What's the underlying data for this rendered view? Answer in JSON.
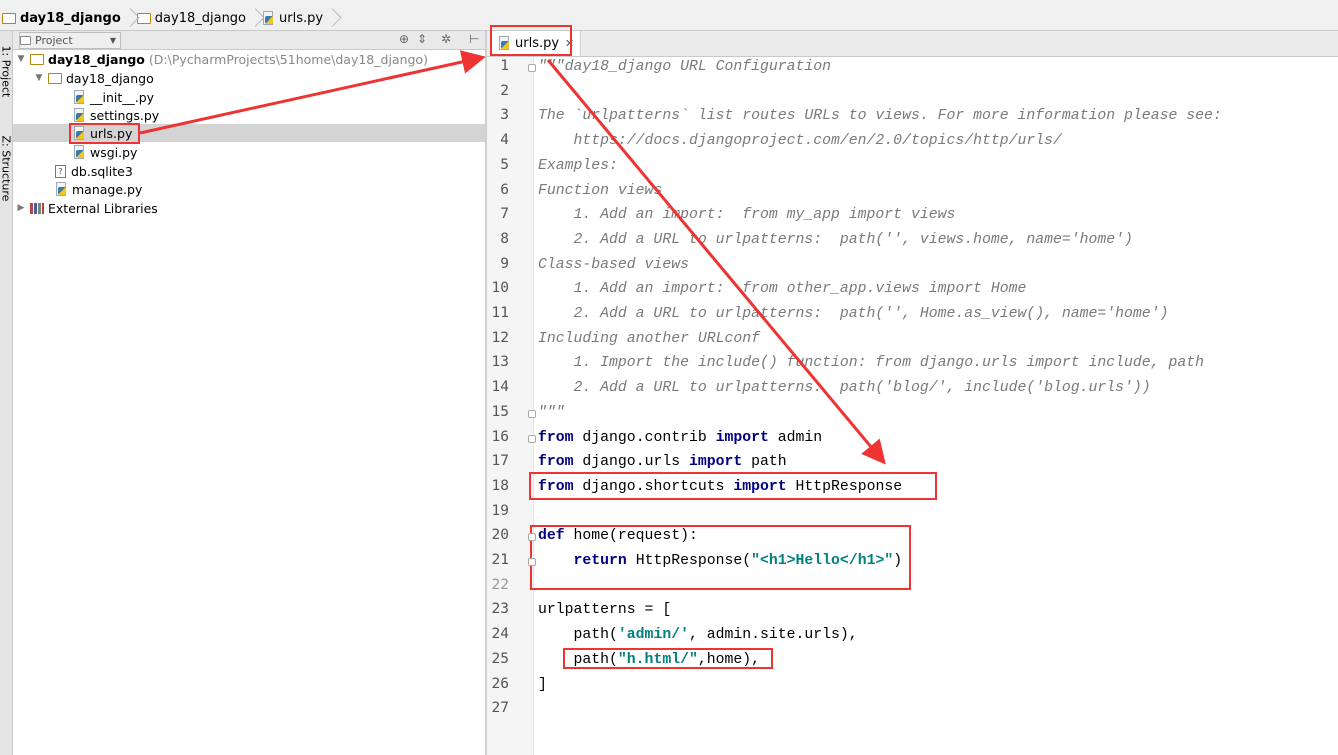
{
  "breadcrumbs": [
    "day18_django",
    "day18_django",
    "urls.py"
  ],
  "project_panel": {
    "selector": "Project",
    "tree": [
      {
        "label": "day18_django",
        "path": "(D:\\PycharmProjects\\51home\\day18_django)",
        "bold": true
      },
      {
        "label": "day18_django"
      },
      {
        "label": "__init__.py"
      },
      {
        "label": "settings.py"
      },
      {
        "label": "urls.py",
        "selected": true
      },
      {
        "label": "wsgi.py"
      },
      {
        "label": "db.sqlite3"
      },
      {
        "label": "manage.py"
      },
      {
        "label": "External Libraries"
      }
    ]
  },
  "side_tabs": [
    "1: Project",
    "Z: Structure"
  ],
  "editor": {
    "tab_label": "urls.py",
    "current_line": 22,
    "lines": [
      [
        [
          "cm",
          "\"\"\"day18_django URL Configuration"
        ]
      ],
      [],
      [
        [
          "cm",
          "The `urlpatterns` list routes URLs to views. For more information please see:"
        ]
      ],
      [
        [
          "cm",
          "    https://docs.djangoproject.com/en/2.0/topics/http/urls/"
        ]
      ],
      [
        [
          "cm",
          "Examples:"
        ]
      ],
      [
        [
          "cm",
          "Function views"
        ]
      ],
      [
        [
          "cm",
          "    1. Add an import:  from my_app import views"
        ]
      ],
      [
        [
          "cm",
          "    2. Add a URL to urlpatterns:  path('', views.home, name='home')"
        ]
      ],
      [
        [
          "cm",
          "Class-based views"
        ]
      ],
      [
        [
          "cm",
          "    1. Add an import:  from other_app.views import Home"
        ]
      ],
      [
        [
          "cm",
          "    2. Add a URL to urlpatterns:  path('', Home.as_view(), name='home')"
        ]
      ],
      [
        [
          "cm",
          "Including another URLconf"
        ]
      ],
      [
        [
          "cm",
          "    1. Import the include() function: from django.urls import include, path"
        ]
      ],
      [
        [
          "cm",
          "    2. Add a URL to urlpatterns:  path('blog/', include('blog.urls'))"
        ]
      ],
      [
        [
          "cm",
          "\"\"\""
        ]
      ],
      [
        [
          "kw",
          "from"
        ],
        [
          "tx",
          " django.contrib "
        ],
        [
          "kw",
          "import"
        ],
        [
          "tx",
          " admin"
        ]
      ],
      [
        [
          "kw",
          "from"
        ],
        [
          "tx",
          " django.urls "
        ],
        [
          "kw",
          "import"
        ],
        [
          "tx",
          " path"
        ]
      ],
      [
        [
          "kw",
          "from"
        ],
        [
          "tx",
          " django.shortcuts "
        ],
        [
          "kw",
          "import"
        ],
        [
          "tx",
          " HttpResponse"
        ]
      ],
      [],
      [
        [
          "kw",
          "def"
        ],
        [
          "tx",
          " home(request):"
        ]
      ],
      [
        [
          "tx",
          "    "
        ],
        [
          "kw",
          "return"
        ],
        [
          "tx",
          " HttpResponse("
        ],
        [
          "st",
          "\"<h1>Hello</h1>\""
        ],
        [
          "tx",
          ")"
        ]
      ],
      [],
      [
        [
          "tx",
          "urlpatterns = ["
        ]
      ],
      [
        [
          "tx",
          "    path("
        ],
        [
          "st",
          "'admin/'"
        ],
        [
          "tx",
          ", admin.site.urls),"
        ]
      ],
      [
        [
          "tx",
          "    path("
        ],
        [
          "st",
          "\"h.html/\""
        ],
        [
          "tx",
          ",home),"
        ]
      ],
      [
        [
          "tx",
          "]"
        ]
      ],
      []
    ]
  },
  "colors": {
    "annotation": "#e33333",
    "keyword": "#000080",
    "string": "#008080",
    "comment": "#7a7a7a"
  }
}
